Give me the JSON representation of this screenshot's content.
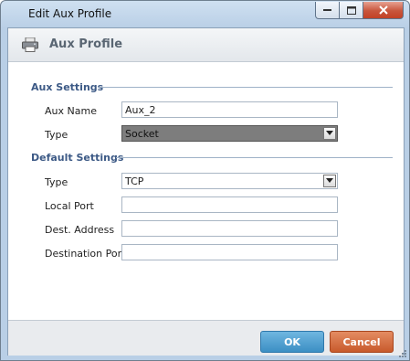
{
  "window": {
    "title": "Edit Aux Profile",
    "controls": {
      "minimize": "—",
      "maximize": "□",
      "close": "✕"
    }
  },
  "header": {
    "icon": "printer-icon",
    "title": "Aux Profile"
  },
  "aux_settings": {
    "section_title": "Aux Settings",
    "aux_name_label": "Aux Name",
    "aux_name_value": "Aux_2",
    "type_label": "Type",
    "type_value": "Socket"
  },
  "default_settings": {
    "section_title": "Default Settings",
    "type_label": "Type",
    "type_value": "TCP",
    "local_port_label": "Local Port",
    "local_port_value": "",
    "dest_address_label": "Dest. Address",
    "dest_address_value": "",
    "destination_port_label": "Destination Port",
    "destination_port_value": ""
  },
  "footer": {
    "ok_label": "OK",
    "cancel_label": "Cancel"
  },
  "colors": {
    "ok_button": "#3c8fc4",
    "cancel_button": "#c85a2c",
    "section_title": "#3d5a86"
  }
}
